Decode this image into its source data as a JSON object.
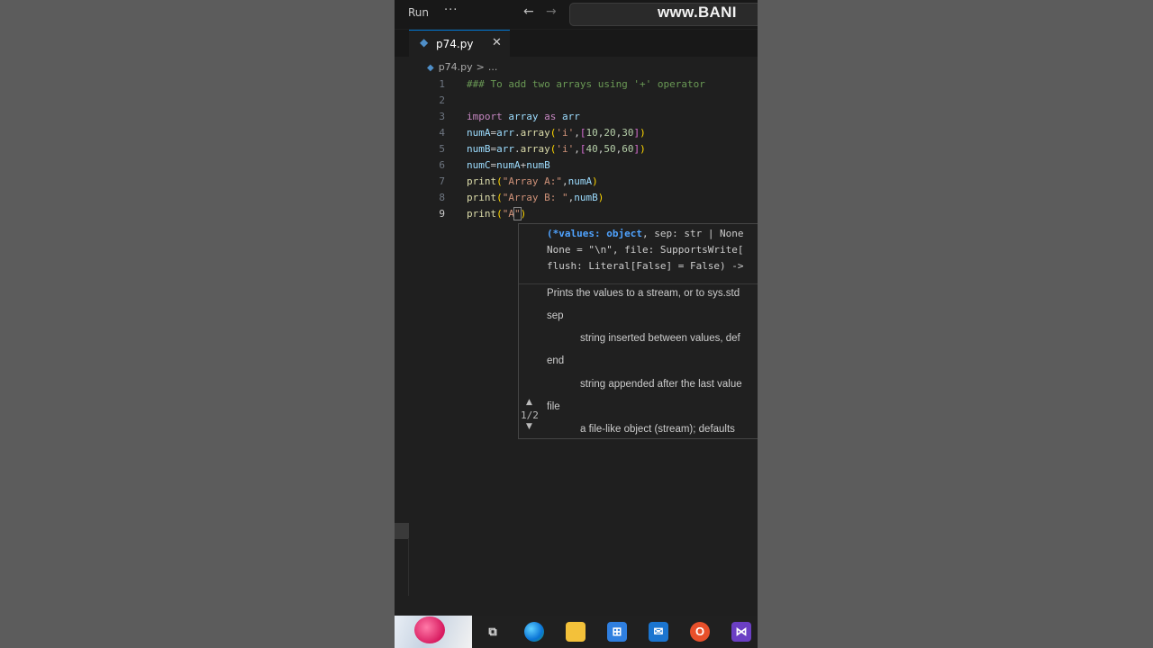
{
  "titlebar": {
    "run_label": "Run",
    "more_glyph": "···",
    "back_glyph": "←",
    "forward_glyph": "→",
    "watermark": "www.BANI"
  },
  "tab": {
    "icon": "python-file-icon",
    "label": "p74.py",
    "close_glyph": "✕"
  },
  "breadcrumb": {
    "file": "p74.py",
    "separator": ">",
    "more": "..."
  },
  "editor": {
    "lines": [
      {
        "n": "1",
        "tokens": [
          {
            "t": "### To add two arrays using '+' operator",
            "c": "c-comment"
          }
        ]
      },
      {
        "n": "2",
        "tokens": []
      },
      {
        "n": "3",
        "tokens": [
          {
            "t": "import",
            "c": "c-kw"
          },
          {
            "t": " array ",
            "c": "c-var"
          },
          {
            "t": "as",
            "c": "c-kw"
          },
          {
            "t": " arr",
            "c": "c-var"
          }
        ]
      },
      {
        "n": "4",
        "tokens": [
          {
            "t": "numA",
            "c": "c-var"
          },
          {
            "t": "=",
            "c": ""
          },
          {
            "t": "arr",
            "c": "c-var"
          },
          {
            "t": ".",
            "c": ""
          },
          {
            "t": "array",
            "c": "c-fn"
          },
          {
            "t": "(",
            "c": "c-br"
          },
          {
            "t": "'i'",
            "c": "c-str"
          },
          {
            "t": ",",
            "c": ""
          },
          {
            "t": "[",
            "c": "c-br2"
          },
          {
            "t": "10",
            "c": "c-num"
          },
          {
            "t": ",",
            "c": ""
          },
          {
            "t": "20",
            "c": "c-num"
          },
          {
            "t": ",",
            "c": ""
          },
          {
            "t": "30",
            "c": "c-num"
          },
          {
            "t": "]",
            "c": "c-br2"
          },
          {
            "t": ")",
            "c": "c-br"
          }
        ]
      },
      {
        "n": "5",
        "tokens": [
          {
            "t": "numB",
            "c": "c-var"
          },
          {
            "t": "=",
            "c": ""
          },
          {
            "t": "arr",
            "c": "c-var"
          },
          {
            "t": ".",
            "c": ""
          },
          {
            "t": "array",
            "c": "c-fn"
          },
          {
            "t": "(",
            "c": "c-br"
          },
          {
            "t": "'i'",
            "c": "c-str"
          },
          {
            "t": ",",
            "c": ""
          },
          {
            "t": "[",
            "c": "c-br2"
          },
          {
            "t": "40",
            "c": "c-num"
          },
          {
            "t": ",",
            "c": ""
          },
          {
            "t": "50",
            "c": "c-num"
          },
          {
            "t": ",",
            "c": ""
          },
          {
            "t": "60",
            "c": "c-num"
          },
          {
            "t": "]",
            "c": "c-br2"
          },
          {
            "t": ")",
            "c": "c-br"
          }
        ]
      },
      {
        "n": "6",
        "tokens": [
          {
            "t": "numC",
            "c": "c-var"
          },
          {
            "t": "=",
            "c": ""
          },
          {
            "t": "numA",
            "c": "c-var"
          },
          {
            "t": "+",
            "c": ""
          },
          {
            "t": "numB",
            "c": "c-var"
          }
        ]
      },
      {
        "n": "7",
        "tokens": [
          {
            "t": "print",
            "c": "c-fn"
          },
          {
            "t": "(",
            "c": "c-br"
          },
          {
            "t": "\"Array A:\"",
            "c": "c-str"
          },
          {
            "t": ",",
            "c": ""
          },
          {
            "t": "numA",
            "c": "c-var"
          },
          {
            "t": ")",
            "c": "c-br"
          }
        ]
      },
      {
        "n": "8",
        "tokens": [
          {
            "t": "print",
            "c": "c-fn"
          },
          {
            "t": "(",
            "c": "c-br"
          },
          {
            "t": "\"Array B: \"",
            "c": "c-str"
          },
          {
            "t": ",",
            "c": ""
          },
          {
            "t": "numB",
            "c": "c-var"
          },
          {
            "t": ")",
            "c": "c-br"
          }
        ]
      },
      {
        "n": "9",
        "active": true,
        "tokens": [
          {
            "t": "print",
            "c": "c-fn"
          },
          {
            "t": "(",
            "c": "c-br"
          },
          {
            "t": "\"A",
            "c": "c-str"
          },
          {
            "t": "\"",
            "c": "c-str cursor-box"
          },
          {
            "t": ")",
            "c": "c-br"
          }
        ]
      }
    ]
  },
  "signature_help": {
    "sig_line1_active": "(*values: object",
    "sig_line1_rest": ", sep: str | None",
    "sig_line2": "None = \"\\n\", file: SupportsWrite[",
    "sig_line3": "flush: Literal[False] = False) ->",
    "doc_summary": "Prints the values to a stream, or to sys.std",
    "param_sep": "sep",
    "param_sep_desc": "string inserted between values, def",
    "param_end": "end",
    "param_end_desc": "string appended after the last value",
    "param_file": "file",
    "param_file_desc": "a file-like object (stream); defaults",
    "pager": "1/2",
    "pager_up": "▲",
    "pager_down": "▼"
  },
  "taskbar": {
    "items": [
      "start-thumbnail",
      "task-view-icon",
      "edge-icon",
      "file-explorer-icon",
      "microsoft-store-icon",
      "mail-icon",
      "office-icon",
      "visual-studio-icon"
    ],
    "task_view_glyph": "⧉",
    "store_glyph": "⊞",
    "mail_glyph": "✉",
    "office_glyph": "O",
    "vs_glyph": "⋈"
  },
  "colors": {
    "editor_bg": "#1f1f1f",
    "comment": "#6a9955",
    "keyword": "#c586c0",
    "variable": "#9cdcfe",
    "function": "#dcdcaa",
    "string": "#ce9178",
    "number": "#b5cea8",
    "accent": "#0078d4"
  }
}
